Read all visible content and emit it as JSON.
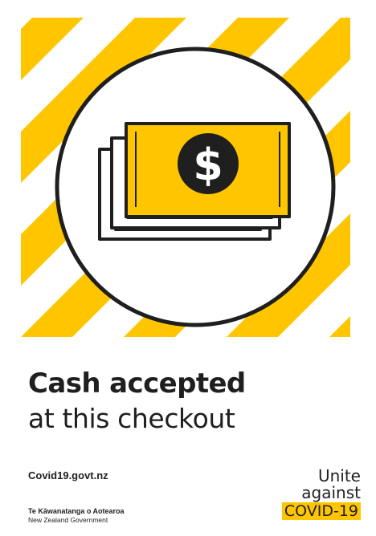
{
  "poster": {
    "headline": "Cash accepted",
    "subheadline": "at this checkout",
    "website": "Covid19.govt.nz",
    "government": {
      "maori_name": "Te Kāwanatanga o Aotearoa",
      "english_name": "New Zealand Government"
    },
    "brand": {
      "line1": "Unite",
      "line2": "against",
      "highlight": "COVID-19"
    },
    "illustration": {
      "icon": "cash-notes-icon",
      "symbol": "$",
      "pattern": "diagonal-stripes"
    },
    "colors": {
      "stripe_yellow": "#ffc600",
      "ink": "#1f1f1f",
      "background": "#ffffff"
    }
  }
}
